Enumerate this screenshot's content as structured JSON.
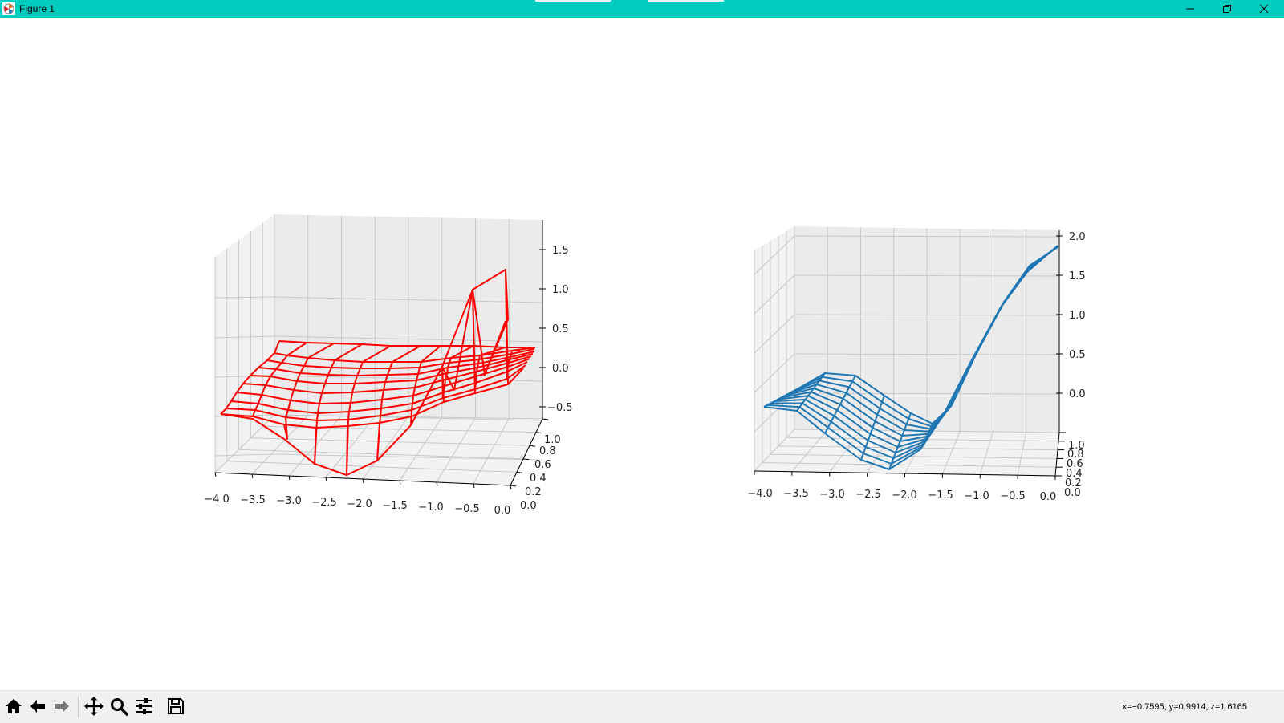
{
  "window": {
    "title": "Figure 1",
    "titlebar_color": "#00cdbf"
  },
  "toolbar": {
    "buttons": [
      {
        "name": "home",
        "icon": "home-icon"
      },
      {
        "name": "back",
        "icon": "arrow-left-icon"
      },
      {
        "name": "forward",
        "icon": "arrow-right-icon"
      },
      {
        "name": "pan",
        "icon": "move-icon"
      },
      {
        "name": "zoom",
        "icon": "magnifier-icon"
      },
      {
        "name": "configure-subplots",
        "icon": "sliders-icon"
      },
      {
        "name": "save",
        "icon": "floppy-disk-icon"
      }
    ],
    "coordinates": "x=−0.7595, y=0.9914, z=1.6165"
  },
  "chart_data": [
    {
      "type": "surface-wireframe-3d",
      "color": "#ff0000",
      "x_ticks": [
        "−4.0",
        "−3.5",
        "−3.0",
        "−2.5",
        "−2.0",
        "−1.5",
        "−1.0",
        "−0.5",
        "0.0"
      ],
      "y_ticks": [
        "0.0",
        "0.2",
        "0.4",
        "0.6",
        "0.8",
        "1.0"
      ],
      "z_ticks": [
        "−0.5",
        "0.0",
        "0.5",
        "1.0",
        "1.5"
      ],
      "xlim": [
        -4.0,
        0.0
      ],
      "ylim": [
        0.0,
        1.0
      ],
      "zlim": [
        -0.7,
        1.8
      ],
      "grid": true
    },
    {
      "type": "surface-wireframe-3d",
      "color": "#1f77b4",
      "x_ticks": [
        "−4.0",
        "−3.5",
        "−3.0",
        "−2.5",
        "−2.0",
        "−1.5",
        "−1.0",
        "−0.5",
        "0.0"
      ],
      "y_ticks": [
        "0.0",
        "0.2",
        "0.4",
        "0.6",
        "0.8",
        "1.0"
      ],
      "z_ticks": [
        "0.0",
        "0.5",
        "1.0",
        "1.5",
        "2.0"
      ],
      "xlim": [
        -4.0,
        0.0
      ],
      "ylim": [
        0.0,
        1.0
      ],
      "zlim": [
        -0.5,
        2.0
      ],
      "grid": true
    }
  ]
}
